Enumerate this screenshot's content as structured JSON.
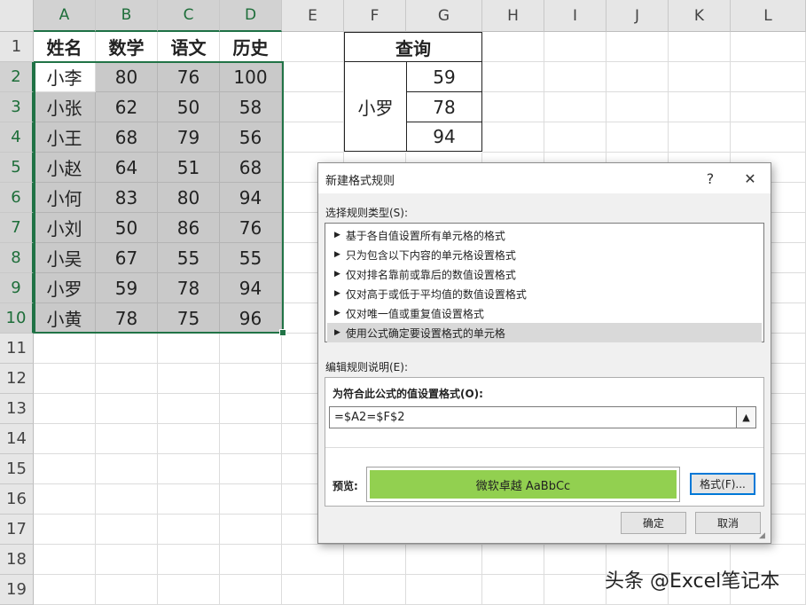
{
  "columns": [
    "A",
    "B",
    "C",
    "D",
    "E",
    "F",
    "G",
    "H",
    "I",
    "J",
    "K",
    "L"
  ],
  "rows": [
    "1",
    "2",
    "3",
    "4",
    "5",
    "6",
    "7",
    "8",
    "9",
    "10",
    "11",
    "12",
    "13",
    "14",
    "15",
    "16",
    "17",
    "18",
    "19"
  ],
  "table": {
    "headers": [
      "姓名",
      "数学",
      "语文",
      "历史"
    ],
    "records": [
      [
        "小李",
        "80",
        "76",
        "100"
      ],
      [
        "小张",
        "62",
        "50",
        "58"
      ],
      [
        "小王",
        "68",
        "79",
        "56"
      ],
      [
        "小赵",
        "64",
        "51",
        "68"
      ],
      [
        "小何",
        "83",
        "80",
        "94"
      ],
      [
        "小刘",
        "50",
        "86",
        "76"
      ],
      [
        "小吴",
        "67",
        "55",
        "55"
      ],
      [
        "小罗",
        "59",
        "78",
        "94"
      ],
      [
        "小黄",
        "78",
        "75",
        "96"
      ]
    ]
  },
  "query": {
    "title": "查询",
    "name": "小罗",
    "values": [
      "59",
      "78",
      "94"
    ]
  },
  "dialog": {
    "title": "新建格式规则",
    "help_label": "?",
    "close_label": "✕",
    "rule_type_label": "选择规则类型(S):",
    "rule_types": [
      "基于各自值设置所有单元格的格式",
      "只为包含以下内容的单元格设置格式",
      "仅对排名靠前或靠后的数值设置格式",
      "仅对高于或低于平均值的数值设置格式",
      "仅对唯一值或重复值设置格式",
      "使用公式确定要设置格式的单元格"
    ],
    "selected_rule_index": 5,
    "edit_label": "编辑规则说明(E):",
    "formula_label": "为符合此公式的值设置格式(O):",
    "formula_value": "=$A2=$F$2",
    "preview_label": "预览:",
    "preview_text": "微软卓越  AaBbCc",
    "preview_color": "#92d050",
    "format_button": "格式(F)...",
    "ok_button": "确定",
    "cancel_button": "取消"
  },
  "watermark": "头条 @Excel笔记本"
}
